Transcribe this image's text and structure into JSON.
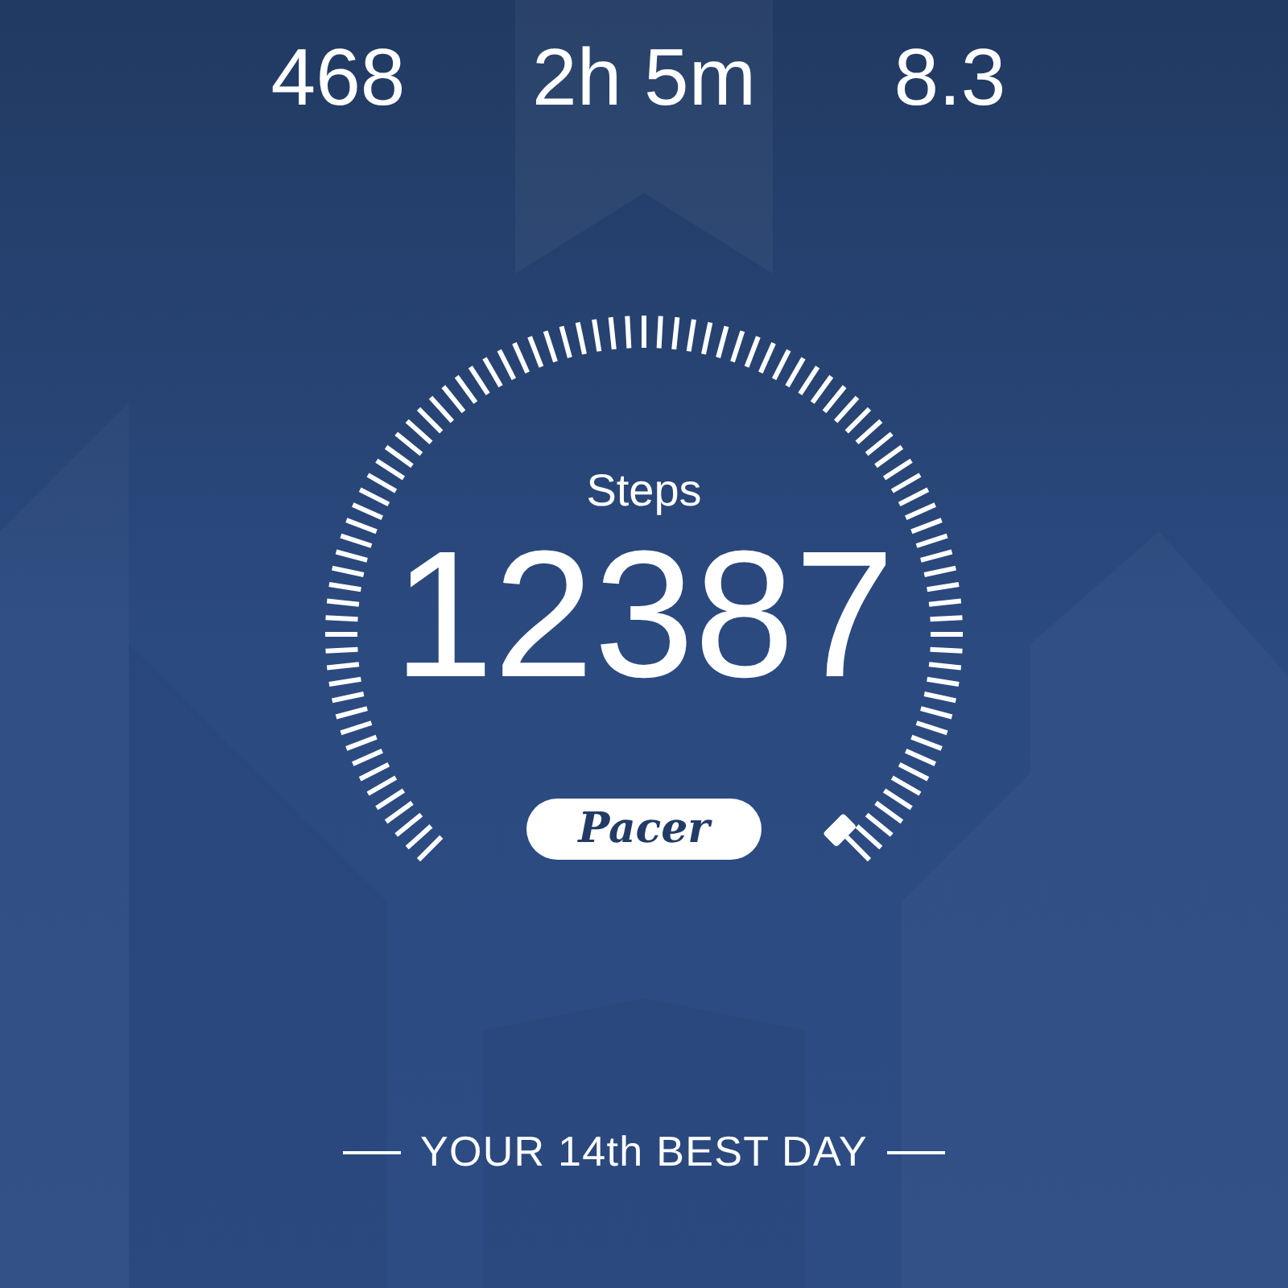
{
  "stats": [
    {
      "value": "468"
    },
    {
      "value": "2h 5m"
    },
    {
      "value": "8.3"
    }
  ],
  "gauge": {
    "label": "Steps",
    "value": "12387"
  },
  "logo": "Pacer",
  "footer": "YOUR 14th BEST DAY"
}
